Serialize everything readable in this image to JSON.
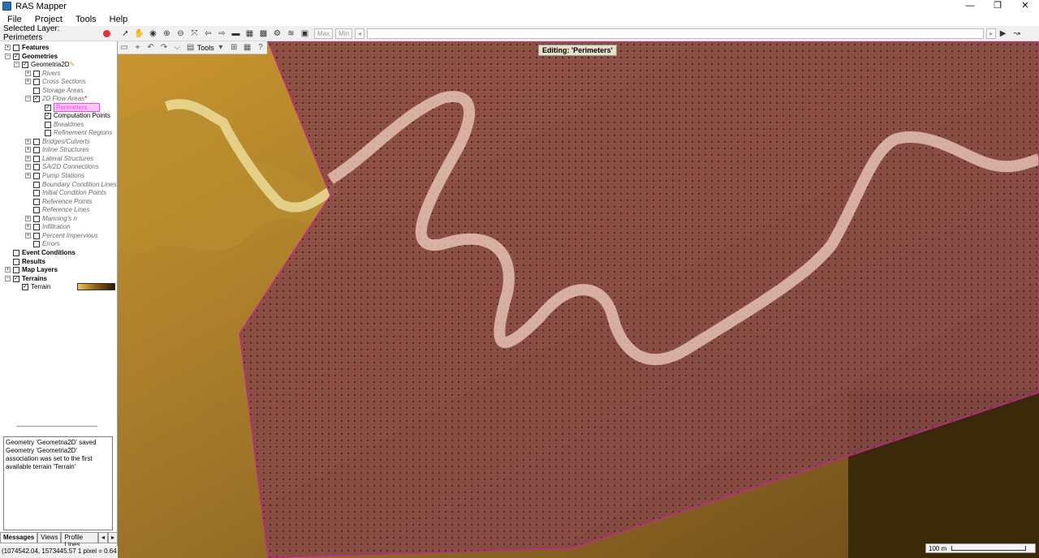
{
  "window": {
    "title": "RAS Mapper",
    "minimize": "—",
    "restore": "❐",
    "close": "✕"
  },
  "menu": [
    "File",
    "Project",
    "Tools",
    "Help"
  ],
  "toolbar": {
    "selected_layer": "Selected Layer: Perimeters",
    "max_label": "Max",
    "min_label": "Min"
  },
  "tree": {
    "features": "Features",
    "geometries": "Geometries",
    "geometry_name": "Geometria2D",
    "rivers": "Rivers",
    "cross_sections": "Cross Sections",
    "storage_areas": "Storage Areas",
    "flow_areas": "2D Flow Areas",
    "perimeters": "Perimeters",
    "computation_points": "Computation Points",
    "breaklines": "Breaklines",
    "refinement_regions": "Refinement Regions",
    "bridges": "Bridges/Culverts",
    "inline": "Inline Structures",
    "lateral": "Lateral Structures",
    "sa2d": "SA/2D Connections",
    "pump": "Pump Stations",
    "bc_lines": "Boundary Condition Lines",
    "ic_points": "Initial Condition Points",
    "ref_points": "Reference Points",
    "ref_lines": "Reference Lines",
    "mannings": "Manning's n",
    "infiltration": "Infiltration",
    "impervious": "Percent Impervious",
    "errors": "Errors",
    "event_conditions": "Event Conditions",
    "results": "Results",
    "map_layers": "Map Layers",
    "terrains": "Terrains",
    "terrain": "Terrain"
  },
  "messages": "Geometry 'Geometria2D' saved\nGeometry 'Geometria2D' association was set to the first available terrain 'Terrain'",
  "tabs": {
    "messages": "Messages",
    "views": "Views",
    "profile_lines": "Profile Lines"
  },
  "status": "(1074542.04, 1573445.57  1 pixel = 0.64",
  "map": {
    "tools": "Tools",
    "help": "?",
    "editing": "Editing: 'Perimeters'",
    "scale": "100 m"
  },
  "colors": {
    "perimeter": "#d020a0",
    "selected_layer_highlight": "#ff40ff",
    "record": "#e43232"
  }
}
